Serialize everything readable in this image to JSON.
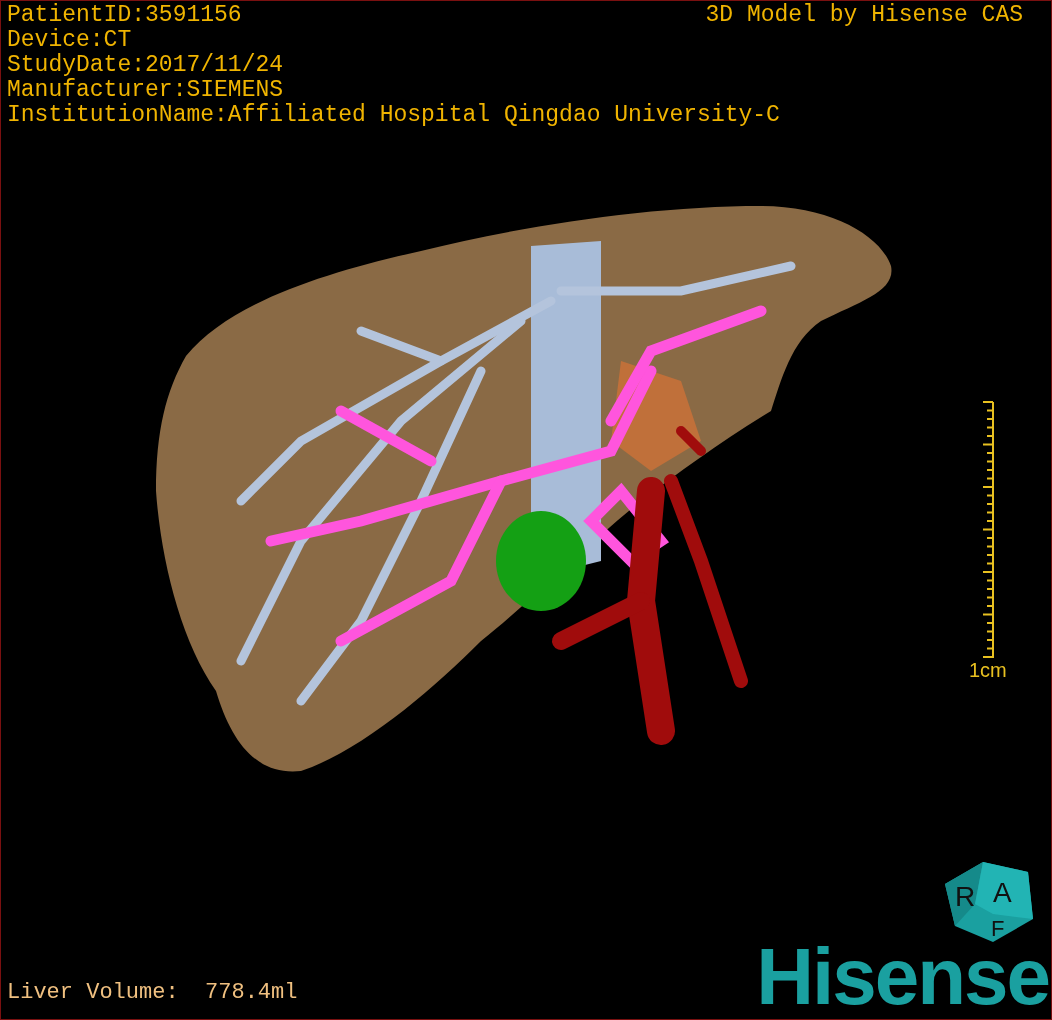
{
  "header": {
    "lines": [
      "PatientID:3591156",
      "Device:CT",
      "StudyDate:2017/11/24",
      "Manufacturer:SIEMENS",
      "InstitutionName:Affiliated Hospital Qingdao University-C"
    ],
    "credit": "3D Model by Hisense CAS"
  },
  "scale_bar": {
    "label": "1cm"
  },
  "orientation_cube": {
    "faces": [
      "R",
      "A",
      "F"
    ]
  },
  "footer": {
    "volume": "Liver Volume:  778.4ml",
    "logo": "Hisense"
  }
}
